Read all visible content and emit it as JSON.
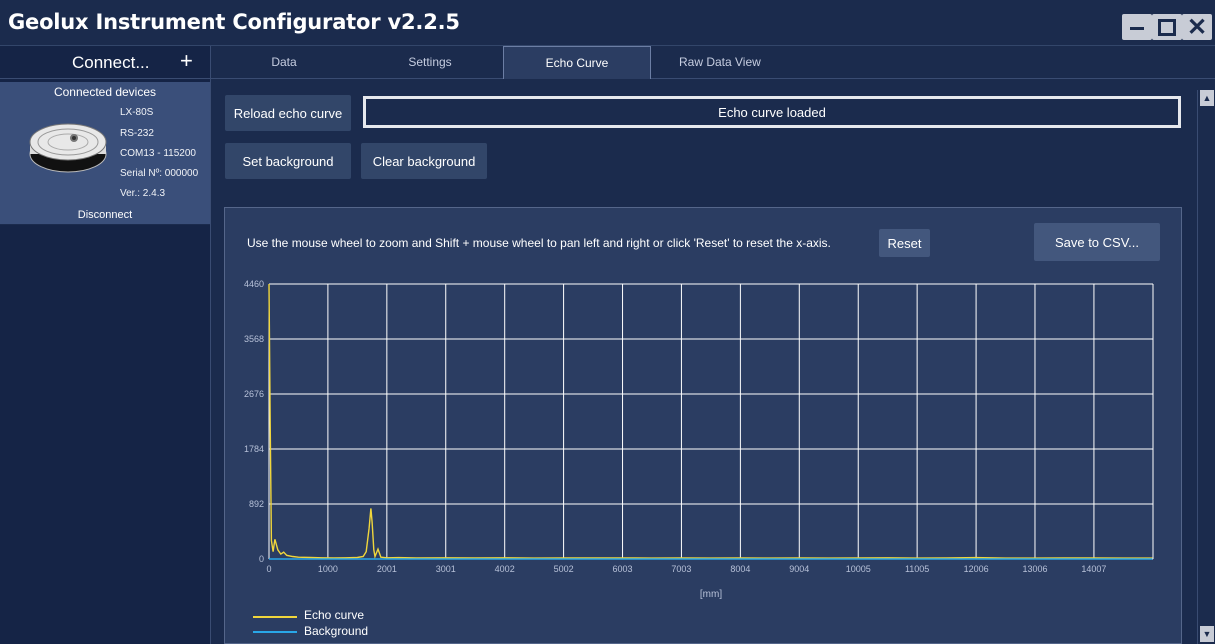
{
  "window": {
    "title": "Geolux Instrument Configurator v2.2.5",
    "minimize_icon": "minimize-icon",
    "maximize_icon": "maximize-icon",
    "close_icon": "close-icon",
    "close_glyph": "✕"
  },
  "sidebar": {
    "connect_label": "Connect...",
    "connect_plus": "+",
    "connected_heading": "Connected devices",
    "device": {
      "model": "LX-80S",
      "interface": "RS-232",
      "port": "COM13 - 115200",
      "serial": "Serial Nº: 000000",
      "version": "Ver.: 2.4.3",
      "disconnect": "Disconnect"
    }
  },
  "tabs": [
    {
      "label": "Data"
    },
    {
      "label": "Settings"
    },
    {
      "label": "Echo Curve"
    },
    {
      "label": "Raw Data View"
    }
  ],
  "active_tab": "Echo Curve",
  "toolbar": {
    "reload_label": "Reload echo curve",
    "status_text": "Echo curve loaded",
    "set_background_label": "Set background",
    "clear_background_label": "Clear background"
  },
  "chart_panel": {
    "hint": "Use the mouse wheel to zoom and Shift + mouse wheel to pan left and right or click 'Reset' to reset the x-axis.",
    "reset_label": "Reset",
    "save_label": "Save to CSV..."
  },
  "colors": {
    "echo": "#f0d63c",
    "background": "#29a7e8",
    "accent": "#2b3d62"
  },
  "chart_data": {
    "type": "line",
    "xlabel": "[mm]",
    "ylabel": "",
    "xlim": [
      0,
      15010
    ],
    "ylim": [
      0,
      4460
    ],
    "x_ticks": [
      "0",
      "1000",
      "2001",
      "3001",
      "4002",
      "5002",
      "6003",
      "7003",
      "8004",
      "9004",
      "10005",
      "11005",
      "12006",
      "13006",
      "14007"
    ],
    "x_tick_values": [
      0,
      1000,
      2001,
      3001,
      4002,
      5002,
      6003,
      7003,
      8004,
      9004,
      10005,
      11005,
      12006,
      13006,
      14007
    ],
    "y_ticks": [
      "0",
      "892",
      "1784",
      "2676",
      "3568",
      "4460"
    ],
    "y_tick_values": [
      0,
      892,
      1784,
      2676,
      3568,
      4460
    ],
    "grid": true,
    "legend_placement": "bottom-left",
    "series": [
      {
        "name": "Echo curve",
        "x": [
          0,
          20,
          40,
          70,
          100,
          150,
          200,
          250,
          300,
          400,
          500,
          700,
          900,
          1100,
          1300,
          1500,
          1600,
          1650,
          1700,
          1730,
          1750,
          1780,
          1800,
          1850,
          1900,
          2000,
          2200,
          2500,
          3000,
          3500,
          4000,
          4500,
          5000,
          5500,
          6000,
          6500,
          7000,
          7500,
          8000,
          8500,
          9000,
          9500,
          10000,
          10500,
          11000,
          11500,
          12000,
          12500,
          13000,
          13500,
          14000,
          14500,
          15000
        ],
        "y": [
          4460,
          2200,
          300,
          120,
          320,
          150,
          80,
          110,
          60,
          40,
          30,
          25,
          20,
          18,
          20,
          25,
          40,
          120,
          500,
          820,
          600,
          150,
          40,
          160,
          30,
          20,
          22,
          18,
          20,
          16,
          20,
          15,
          18,
          16,
          18,
          14,
          18,
          15,
          16,
          14,
          18,
          14,
          16,
          20,
          14,
          16,
          22,
          14,
          15,
          18,
          16,
          14,
          15
        ]
      },
      {
        "name": "Background",
        "x": [
          0,
          15000
        ],
        "y": [
          0,
          0
        ]
      }
    ]
  }
}
